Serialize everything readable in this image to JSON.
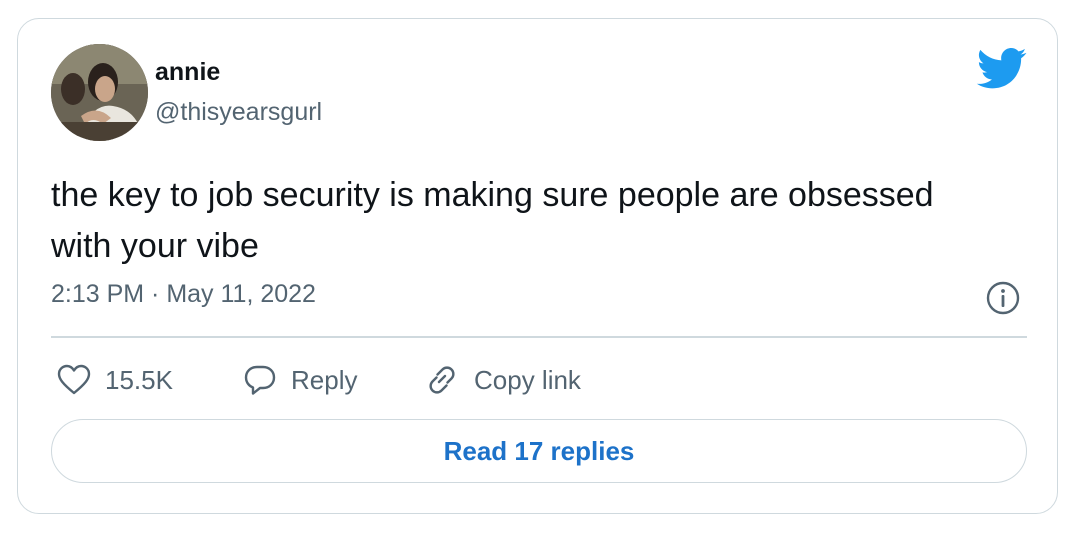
{
  "author": {
    "name": "annie",
    "handle": "@thisyearsgurl"
  },
  "tweet": {
    "text": "the key to job security is making sure people are obsessed with your vibe",
    "timestamp": "2:13 PM · May 11, 2022"
  },
  "actions": {
    "likes": "15.5K",
    "reply_label": "Reply",
    "copy_label": "Copy link"
  },
  "read_replies_label": "Read 17 replies",
  "icons": {
    "logo": "twitter-bird-icon",
    "info": "info-icon",
    "like": "heart-icon",
    "reply": "speech-bubble-icon",
    "copy": "link-icon"
  },
  "colors": {
    "brand": "#1d9bf0",
    "link": "#1d72c9",
    "secondary_text": "#536471",
    "border": "#cfd9de"
  }
}
